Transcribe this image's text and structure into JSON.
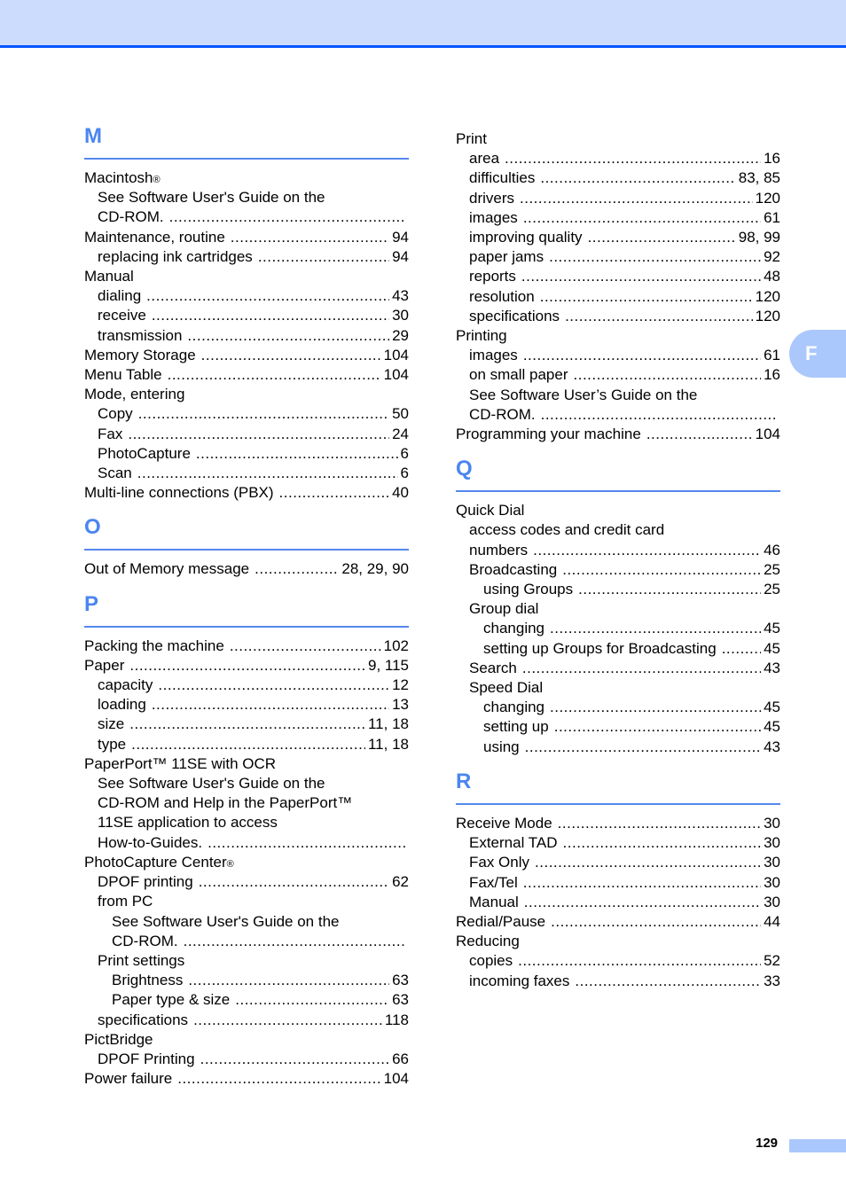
{
  "side_tab": {
    "label": "F"
  },
  "footer": {
    "page_number": "129"
  },
  "sections": {
    "M": {
      "letter": "M",
      "entries": [
        {
          "text": "Macintosh",
          "sup": "®",
          "level": 0
        },
        {
          "text": "See Software User's Guide on the",
          "level": 1
        },
        {
          "text": "CD-ROM.",
          "level": 1,
          "dots": true,
          "page": ""
        },
        {
          "text": "Maintenance, routine",
          "level": 0,
          "dots": true,
          "page": "94"
        },
        {
          "text": "replacing ink cartridges",
          "level": 1,
          "dots": true,
          "page": "94"
        },
        {
          "text": "Manual",
          "level": 0
        },
        {
          "text": "dialing",
          "level": 1,
          "dots": true,
          "page": "43"
        },
        {
          "text": "receive",
          "level": 1,
          "dots": true,
          "page": "30"
        },
        {
          "text": "transmission",
          "level": 1,
          "dots": true,
          "page": "29"
        },
        {
          "text": "Memory Storage",
          "level": 0,
          "dots": true,
          "page": "104"
        },
        {
          "text": "Menu Table",
          "level": 0,
          "dots": true,
          "page": "104"
        },
        {
          "text": "Mode, entering",
          "level": 0
        },
        {
          "text": "Copy",
          "level": 1,
          "dots": true,
          "page": "50"
        },
        {
          "text": "Fax",
          "level": 1,
          "dots": true,
          "page": "24"
        },
        {
          "text": "PhotoCapture",
          "level": 1,
          "dots": true,
          "page": "6"
        },
        {
          "text": "Scan",
          "level": 1,
          "dots": true,
          "page": "6"
        },
        {
          "text": "Multi-line connections (PBX)",
          "level": 0,
          "dots": true,
          "page": "40"
        }
      ]
    },
    "O": {
      "letter": "O",
      "entries": [
        {
          "text": "Out of Memory message",
          "level": 0,
          "dots": true,
          "page": "28, 29, 90"
        }
      ]
    },
    "P": {
      "letter": "P",
      "entries": [
        {
          "text": "Packing the machine",
          "level": 0,
          "dots": true,
          "page": "102"
        },
        {
          "text": "Paper",
          "level": 0,
          "dots": true,
          "page": "9, 115"
        },
        {
          "text": "capacity",
          "level": 1,
          "dots": true,
          "page": "12"
        },
        {
          "text": "loading",
          "level": 1,
          "dots": true,
          "page": "13"
        },
        {
          "text": "size",
          "level": 1,
          "dots": true,
          "page": "11, 18"
        },
        {
          "text": "type",
          "level": 1,
          "dots": true,
          "page": "11, 18"
        },
        {
          "text": "PaperPort™ 11SE with OCR",
          "level": 0
        },
        {
          "text": "See Software User's Guide on the",
          "level": 1
        },
        {
          "text": "CD-ROM and Help in the PaperPort™",
          "level": 1
        },
        {
          "text": "11SE application to access",
          "level": 1
        },
        {
          "text": "How-to-Guides.",
          "level": 1,
          "dots": true,
          "page": ""
        },
        {
          "text": "PhotoCapture Center",
          "sup": "®",
          "level": 0
        },
        {
          "text": "DPOF printing",
          "level": 1,
          "dots": true,
          "page": "62"
        },
        {
          "text": "from PC",
          "level": 1
        },
        {
          "text": "See Software User's Guide on the",
          "level": 2
        },
        {
          "text": "CD-ROM.",
          "level": 2,
          "dots": true,
          "page": ""
        },
        {
          "text": "Print settings",
          "level": 1
        },
        {
          "text": "Brightness",
          "level": 2,
          "dots": true,
          "page": "63"
        },
        {
          "text": "Paper type & size",
          "level": 2,
          "dots": true,
          "page": "63"
        },
        {
          "text": "specifications",
          "level": 1,
          "dots": true,
          "page": "118"
        },
        {
          "text": "PictBridge",
          "level": 0
        },
        {
          "text": "DPOF Printing",
          "level": 1,
          "dots": true,
          "page": "66"
        },
        {
          "text": "Power failure",
          "level": 0,
          "dots": true,
          "page": "104"
        }
      ]
    },
    "P_cont": {
      "entries": [
        {
          "text": "Print",
          "level": 0
        },
        {
          "text": "area",
          "level": 1,
          "dots": true,
          "page": "16"
        },
        {
          "text": "difficulties",
          "level": 1,
          "dots": true,
          "page": "83, 85"
        },
        {
          "text": "drivers",
          "level": 1,
          "dots": true,
          "page": "120"
        },
        {
          "text": "images",
          "level": 1,
          "dots": true,
          "page": "61"
        },
        {
          "text": "improving quality",
          "level": 1,
          "dots": true,
          "page": "98, 99"
        },
        {
          "text": "paper jams",
          "level": 1,
          "dots": true,
          "page": "92"
        },
        {
          "text": "reports",
          "level": 1,
          "dots": true,
          "page": "48"
        },
        {
          "text": "resolution",
          "level": 1,
          "dots": true,
          "page": "120"
        },
        {
          "text": "specifications",
          "level": 1,
          "dots": true,
          "page": "120"
        },
        {
          "text": "Printing",
          "level": 0
        },
        {
          "text": "images",
          "level": 1,
          "dots": true,
          "page": "61"
        },
        {
          "text": "on small paper",
          "level": 1,
          "dots": true,
          "page": "16"
        },
        {
          "text": "See Software User’s Guide on the",
          "level": 1
        },
        {
          "text": "CD-ROM.",
          "level": 1,
          "dots": true,
          "page": ""
        },
        {
          "text": "Programming your machine",
          "level": 0,
          "dots": true,
          "page": "104"
        }
      ]
    },
    "Q": {
      "letter": "Q",
      "entries": [
        {
          "text": "Quick Dial",
          "level": 0
        },
        {
          "text": "access codes and credit card",
          "level": 1
        },
        {
          "text": "numbers",
          "level": 1,
          "dots": true,
          "page": "46"
        },
        {
          "text": "Broadcasting",
          "level": 1,
          "dots": true,
          "page": "25"
        },
        {
          "text": "using Groups",
          "level": 2,
          "dots": true,
          "page": "25"
        },
        {
          "text": "Group dial",
          "level": 1
        },
        {
          "text": "changing",
          "level": 2,
          "dots": true,
          "page": "45"
        },
        {
          "text": "setting up Groups for Broadcasting",
          "level": 2,
          "dots": true,
          "page": "45"
        },
        {
          "text": "Search",
          "level": 1,
          "dots": true,
          "page": "43"
        },
        {
          "text": "Speed Dial",
          "level": 1
        },
        {
          "text": "changing",
          "level": 2,
          "dots": true,
          "page": "45"
        },
        {
          "text": "setting up",
          "level": 2,
          "dots": true,
          "page": "45"
        },
        {
          "text": "using",
          "level": 2,
          "dots": true,
          "page": "43"
        }
      ]
    },
    "R": {
      "letter": "R",
      "entries": [
        {
          "text": "Receive Mode",
          "level": 0,
          "dots": true,
          "page": "30"
        },
        {
          "text": "External TAD",
          "level": 1,
          "dots": true,
          "page": "30"
        },
        {
          "text": "Fax Only",
          "level": 1,
          "dots": true,
          "page": "30"
        },
        {
          "text": "Fax/Tel",
          "level": 1,
          "dots": true,
          "page": "30"
        },
        {
          "text": "Manual",
          "level": 1,
          "dots": true,
          "page": "30"
        },
        {
          "text": "Redial/Pause",
          "level": 0,
          "dots": true,
          "page": "44"
        },
        {
          "text": "Reducing",
          "level": 0
        },
        {
          "text": "copies",
          "level": 1,
          "dots": true,
          "page": "52"
        },
        {
          "text": "incoming faxes",
          "level": 1,
          "dots": true,
          "page": "33"
        }
      ]
    }
  }
}
